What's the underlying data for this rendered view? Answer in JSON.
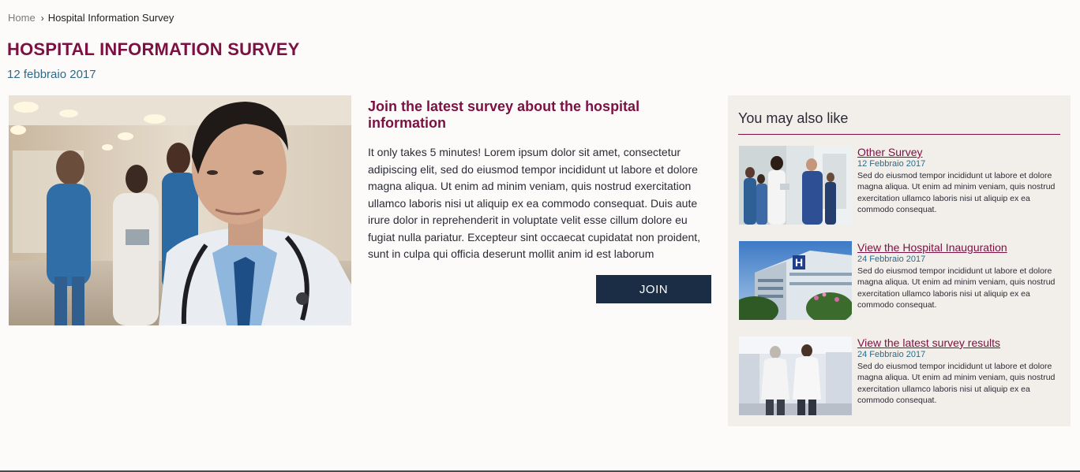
{
  "breadcrumb": {
    "home": "Home",
    "separator": "›",
    "current": "Hospital Information Survey"
  },
  "page": {
    "title": "HOSPITAL INFORMATION SURVEY",
    "date": "12 febbraio 2017"
  },
  "article": {
    "heading": "Join the latest survey about the hospital information",
    "body": "It only takes 5 minutes! Lorem ipsum dolor sit amet, consectetur adipiscing elit, sed do eiusmod tempor incididunt ut labore et dolore magna aliqua. Ut enim ad minim veniam, quis nostrud exercitation ullamco laboris nisi ut aliquip ex ea commodo consequat. Duis aute irure dolor in reprehenderit in voluptate velit esse cillum dolore eu fugiat nulla pariatur. Excepteur sint occaecat cupidatat non proident, sunt in culpa qui officia deserunt mollit anim id est laborum",
    "join_label": "JOIN"
  },
  "sidebar": {
    "title": "You may also like",
    "items": [
      {
        "title": "Other Survey",
        "date": "12 Febbraio 2017",
        "desc": "Sed do eiusmod tempor incididunt ut labore et dolore magna aliqua. Ut enim ad minim veniam, quis nostrud exercitation ullamco laboris nisi ut aliquip ex ea commodo consequat."
      },
      {
        "title": "View the Hospital Inauguration",
        "date": "24 Febbraio 2017",
        "desc": "Sed do eiusmod tempor incididunt ut labore et dolore magna aliqua. Ut enim ad minim veniam, quis nostrud exercitation ullamco laboris nisi ut aliquip ex ea commodo consequat."
      },
      {
        "title": "View the latest survey results",
        "date": "24 Febbraio 2017",
        "desc": "Sed do eiusmod tempor incididunt ut labore et dolore magna aliqua. Ut enim ad minim veniam, quis nostrud exercitation ullamco laboris nisi ut aliquip ex ea commodo consequat."
      }
    ]
  },
  "colors": {
    "brand": "#7d1042",
    "date": "#2d6a8a",
    "button": "#1a2d45",
    "sidebar_bg": "#f2eeea"
  },
  "icons": {
    "breadcrumb_separator": "chevron-right-icon",
    "hospital_sign": "hospital-h-icon"
  }
}
